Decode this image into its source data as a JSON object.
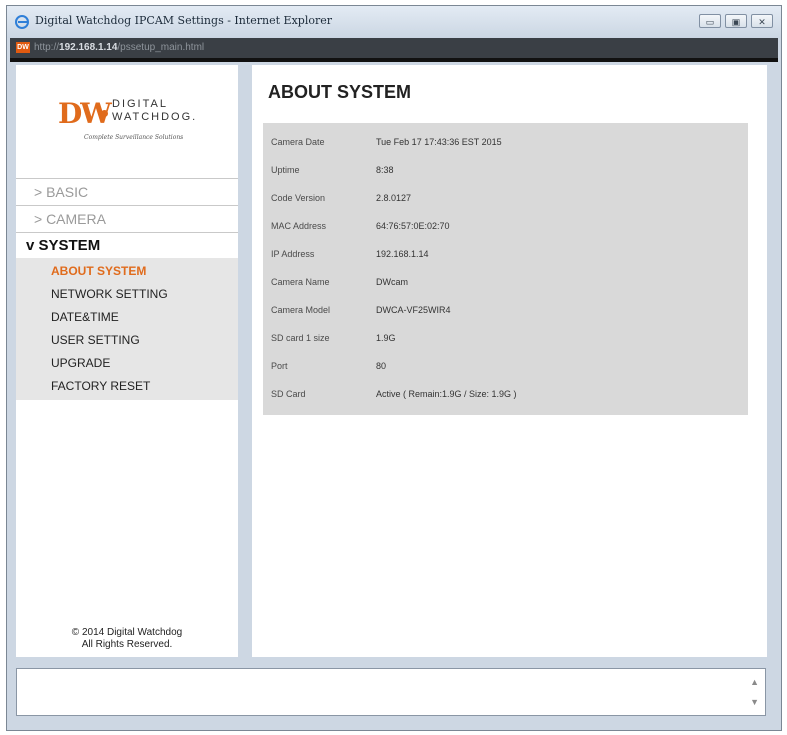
{
  "window": {
    "title": "Digital Watchdog IPCAM Settings - Internet Explorer",
    "buttons": {
      "minimize": "▭",
      "maximize": "▣",
      "close": "✕"
    }
  },
  "address": {
    "prefix": "http://",
    "host": "192.168.1.14",
    "path": "/pssetup_main.html"
  },
  "logo": {
    "mark": "DW",
    "line1": "DIGITAL",
    "line2": "WATCHDOG.",
    "tagline": "Complete Surveillance Solutions"
  },
  "nav": {
    "basic": "> BASIC",
    "camera": "> CAMERA",
    "system": "v SYSTEM",
    "sub": [
      "ABOUT SYSTEM",
      "NETWORK SETTING",
      "DATE&TIME",
      "USER SETTING",
      "UPGRADE",
      "FACTORY RESET"
    ]
  },
  "footer": {
    "line1": "© 2014 Digital Watchdog",
    "line2": "All Rights Reserved."
  },
  "main": {
    "title": "ABOUT SYSTEM",
    "rows": [
      {
        "label": "Camera Date",
        "value": "Tue Feb 17 17:43:36 EST 2015"
      },
      {
        "label": "Uptime",
        "value": "8:38"
      },
      {
        "label": "Code Version",
        "value": "2.8.0127"
      },
      {
        "label": "MAC Address",
        "value": "64:76:57:0E:02:70"
      },
      {
        "label": "IP Address",
        "value": "192.168.1.14"
      },
      {
        "label": "Camera Name",
        "value": "DWcam"
      },
      {
        "label": "Camera Model",
        "value": "DWCA-VF25WIR4"
      },
      {
        "label": "SD card 1 size",
        "value": "1.9G"
      },
      {
        "label": "Port",
        "value": "80"
      },
      {
        "label": "SD Card",
        "value": "Active ( Remain:1.9G / Size: 1.9G )"
      }
    ]
  },
  "status": {
    "scroll_up": "▲",
    "scroll_down": "▼"
  },
  "colors": {
    "accent": "#e06b1c",
    "info_bg": "#d9d9d9",
    "submenu_bg": "#e6e6e6"
  }
}
